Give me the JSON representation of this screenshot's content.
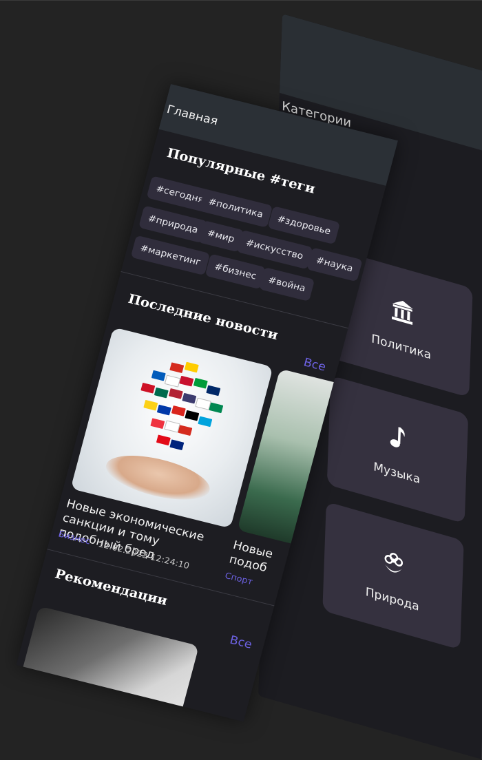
{
  "categories_screen": {
    "title": "Категории",
    "items": [
      {
        "label": "Политика",
        "icon": "bank-icon"
      },
      {
        "label": "Музыка",
        "icon": "music-note-icon"
      },
      {
        "label": "Природа",
        "icon": "flower-icon"
      }
    ]
  },
  "main_screen": {
    "title": "Главная",
    "tags_section": {
      "title": "Популярные #теги",
      "tags": [
        "#сегодня",
        "#политика",
        "#здоровье",
        "#природа",
        "#мир",
        "#искусство",
        "#наука",
        "#маркетинг",
        "#бизнес",
        "#война"
      ]
    },
    "latest_news": {
      "title": "Последние новости",
      "all_link": "Все",
      "items": [
        {
          "title": "Новые экономические санкции и тому подобный бред",
          "category": "Бизнес",
          "date": "12.02.2023 12:24:10"
        },
        {
          "title": "Новые подоб",
          "category": "Спорт",
          "date": ""
        }
      ]
    },
    "recommendations": {
      "title": "Рекомендации",
      "all_link": "Все"
    }
  },
  "colors": {
    "background": "#232323",
    "accent": "#6e63e6",
    "card": "#35313f",
    "tag": "#302d3c",
    "header": "#2b3036"
  }
}
